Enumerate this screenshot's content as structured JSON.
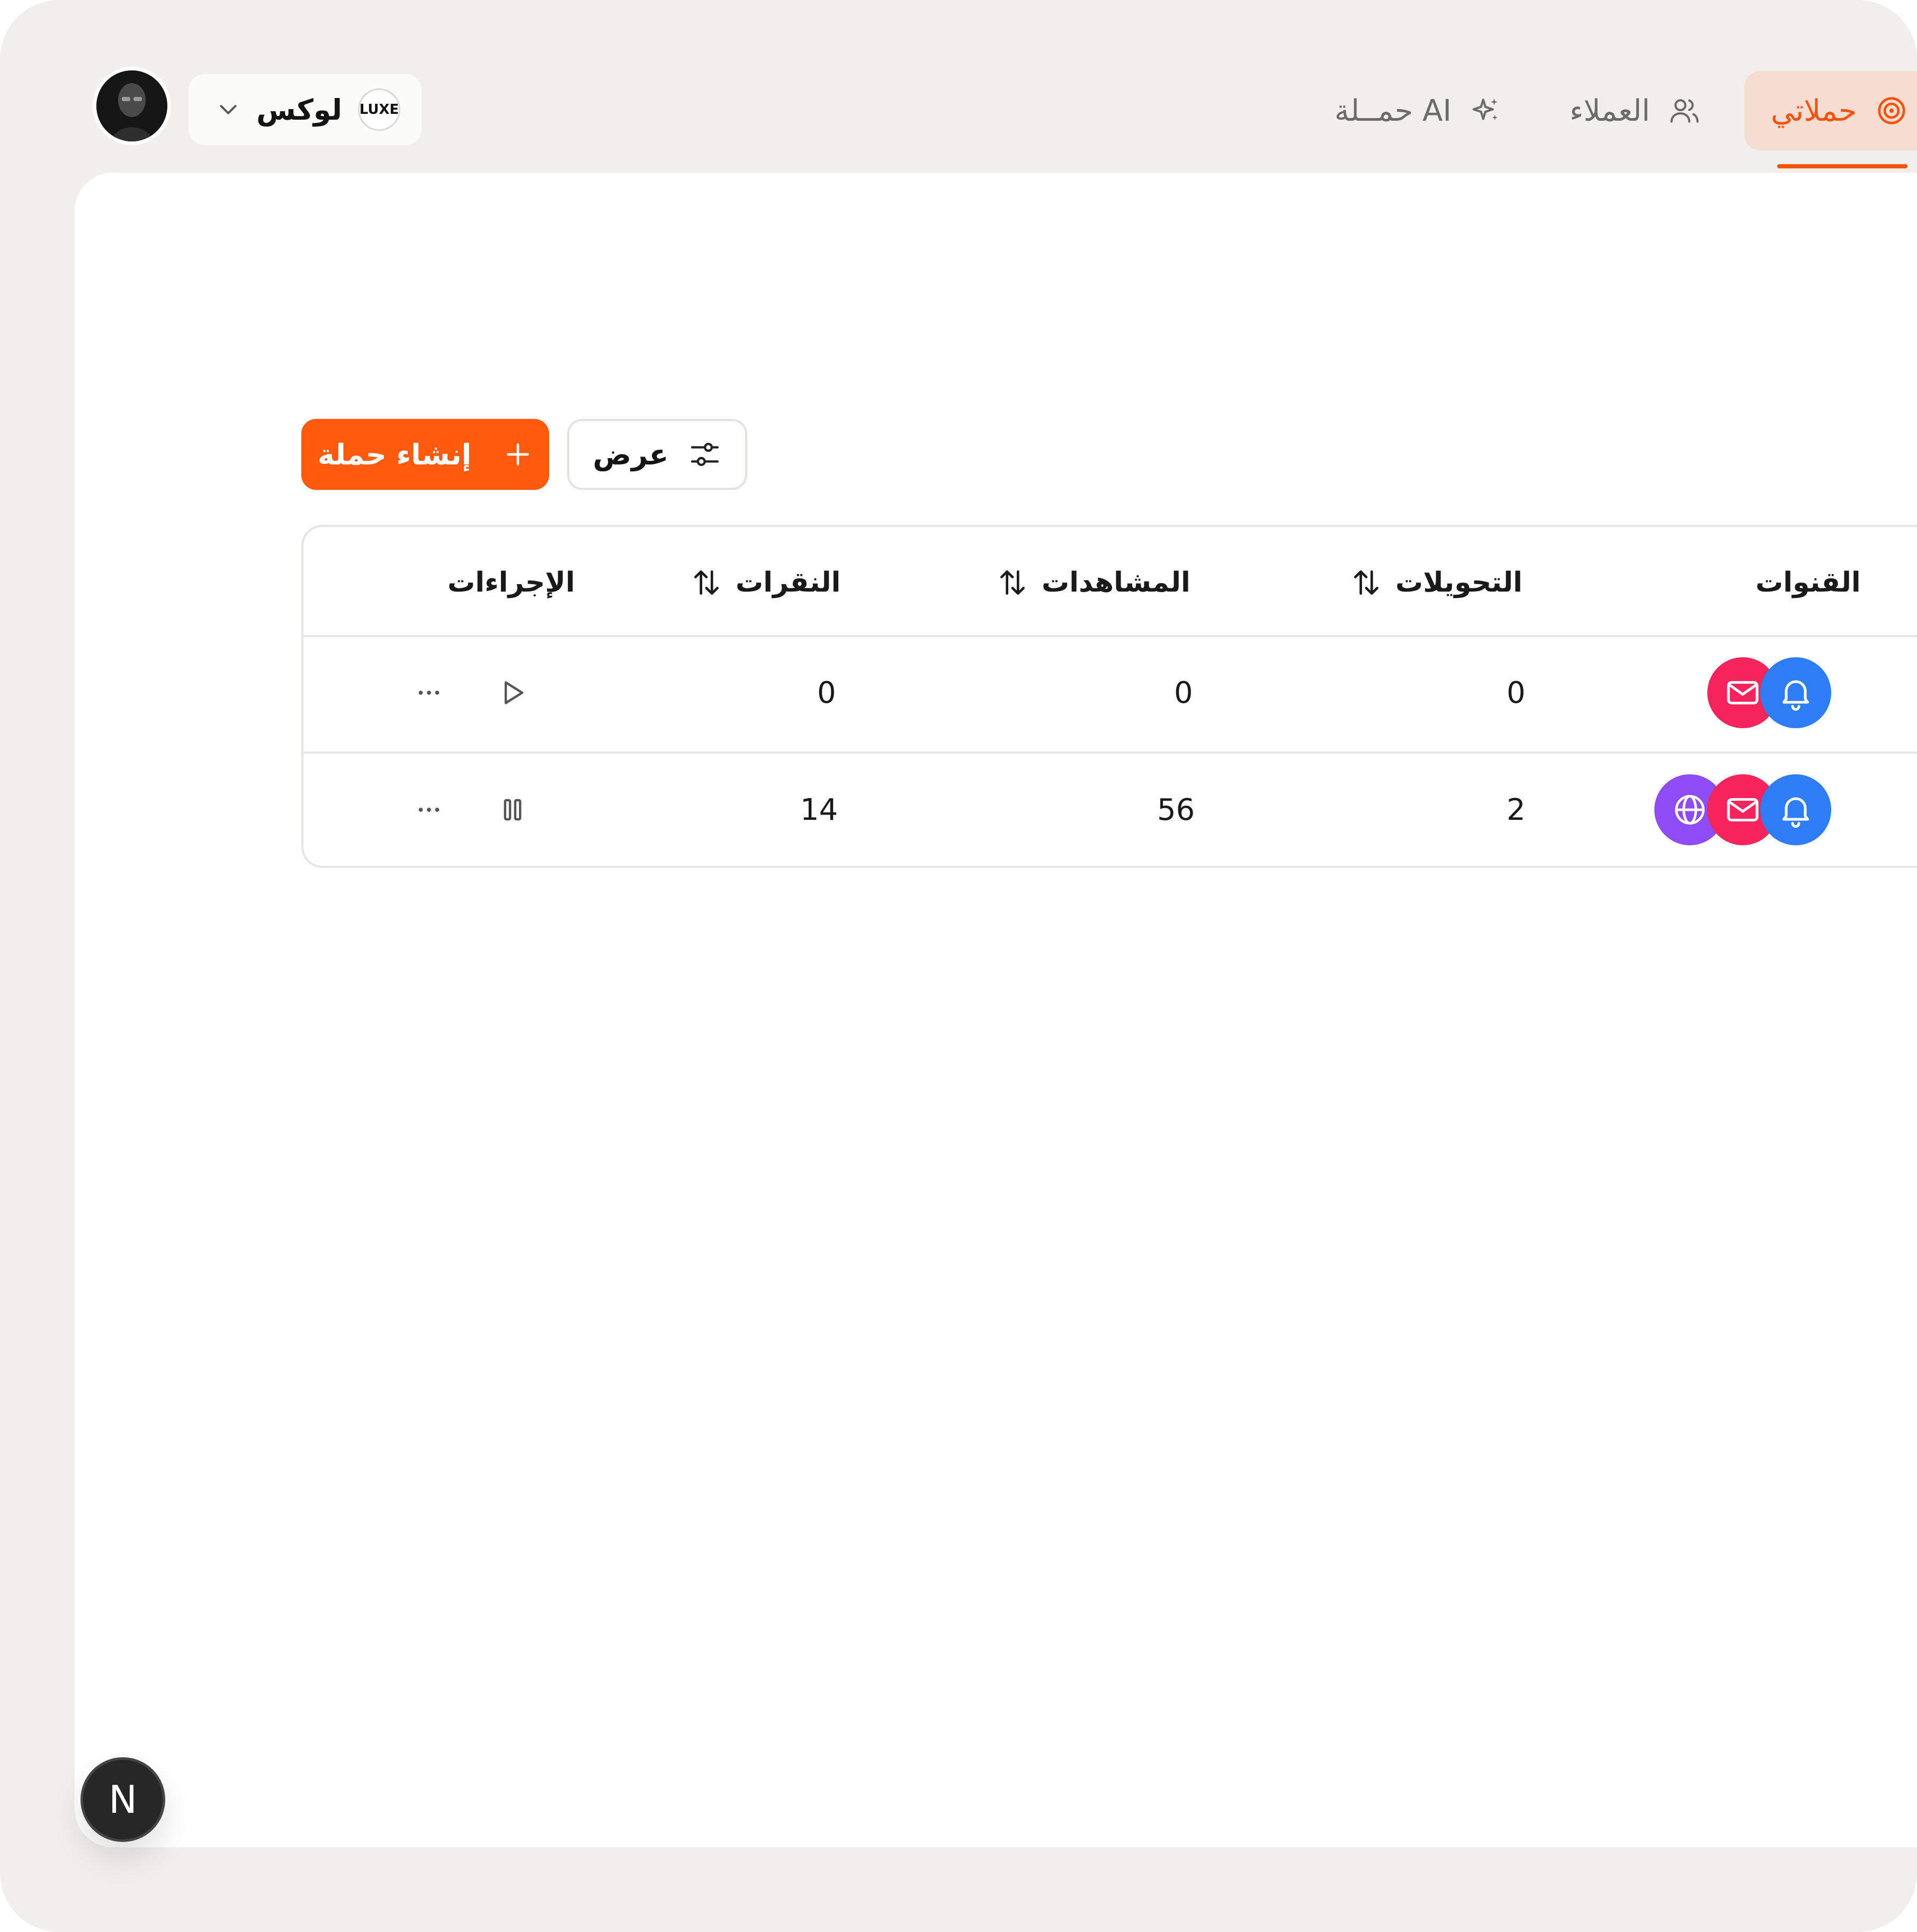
{
  "header": {
    "org": {
      "name": "لوكس",
      "badge": "LUXE"
    },
    "nav": {
      "campaigns": "حملاتي",
      "customers": "العملاء",
      "ai_campaign": "حمــلة AI"
    }
  },
  "toolbar": {
    "create_label": "إنشاء حملة",
    "view_label": "عرض"
  },
  "table": {
    "columns": {
      "channels": "القنوات",
      "conversions": "التحويلات",
      "views": "المشاهدات",
      "clicks": "النقرات",
      "actions": "الإجراءات"
    },
    "rows": [
      {
        "channels": [
          "bell",
          "mail"
        ],
        "conversions": "0",
        "views": "0",
        "clicks": "0",
        "status": "play"
      },
      {
        "channels": [
          "bell",
          "mail",
          "globe"
        ],
        "conversions": "2",
        "views": "56",
        "clicks": "14",
        "status": "pause"
      }
    ]
  },
  "dev_badge": {
    "letter": "N"
  },
  "colors": {
    "accent": "#ff5a0d",
    "accent_soft": "#f7dcd1",
    "channel_bell": "#2f7df6",
    "channel_mail": "#f5245a",
    "channel_web": "#8d4cf5",
    "background": "#f0efeb"
  }
}
